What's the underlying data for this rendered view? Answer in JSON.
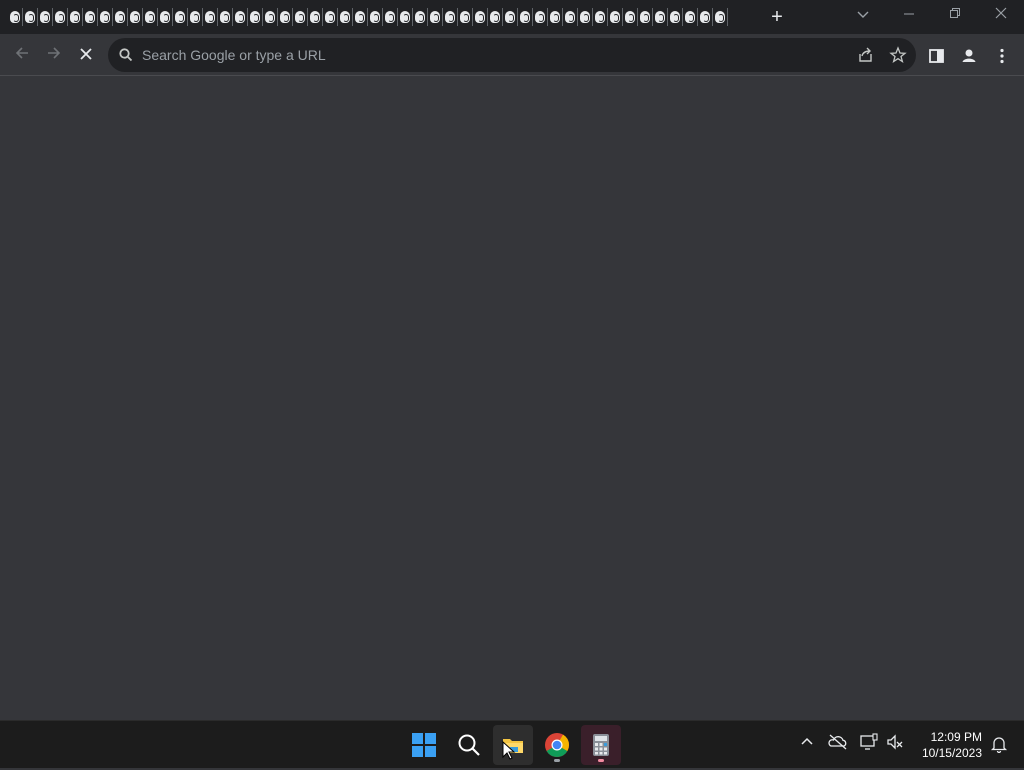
{
  "browser": {
    "tab_count": 48,
    "tab_favicon": "generic-site-favicon",
    "new_tab_symbol": "+",
    "omnibox": {
      "placeholder": "Search Google or type a URL",
      "value": ""
    },
    "window_controls": [
      "tab-search",
      "minimize",
      "restore",
      "close"
    ],
    "toolbar_icons": [
      "back-icon",
      "forward-icon",
      "stop-icon",
      "share-icon",
      "bookmark-star-icon",
      "side-panel-icon",
      "profile-icon",
      "menu-icon"
    ]
  },
  "taskbar": {
    "apps": [
      "windows-start",
      "search",
      "file-explorer",
      "chrome",
      "calculator"
    ],
    "tray_icons": [
      "chevron-up-icon",
      "onedrive-offline-icon",
      "network-icon",
      "volume-muted-icon"
    ],
    "clock": {
      "time": "12:09 PM",
      "date": "10/15/2023"
    }
  },
  "colors": {
    "tabstrip_bg": "#202124",
    "toolbar_bg": "#35363a",
    "omnibox_bg": "#202124",
    "taskbar_bg": "#1c1c1c",
    "calc_highlight": "#3a1f2a"
  }
}
